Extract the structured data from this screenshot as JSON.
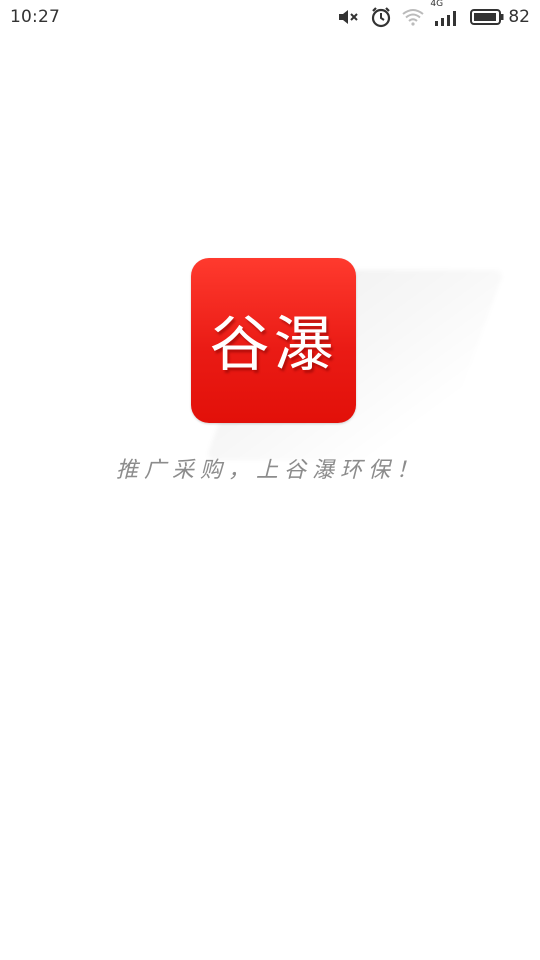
{
  "status_bar": {
    "time": "10:27",
    "network_type": "4G",
    "battery_level": "82",
    "icons": [
      "mute-icon",
      "alarm-icon",
      "wifi-icon",
      "cellular-signal-icon",
      "battery-icon"
    ]
  },
  "splash": {
    "logo_text": "谷瀑",
    "slogan": "推广采购，上谷瀑环保！",
    "brand_color": "#e8150f"
  }
}
